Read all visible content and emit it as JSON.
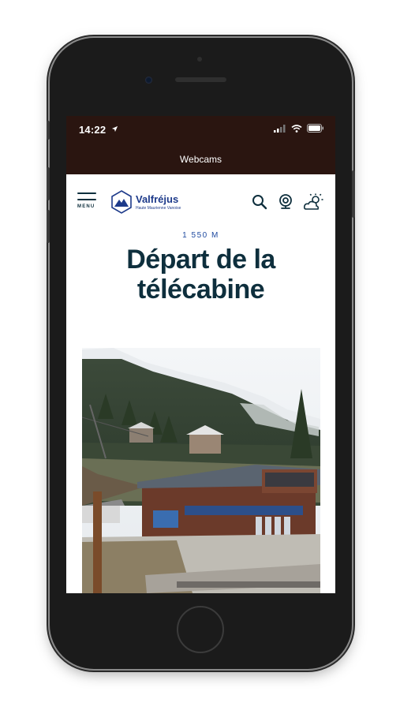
{
  "status_bar": {
    "time": "14:22"
  },
  "nav": {
    "title": "Webcams"
  },
  "header": {
    "menu_label": "MENU",
    "logo_name": "Valfréjus",
    "logo_tagline": "Haute Maurienne Vanoise"
  },
  "page": {
    "altitude": "1 550 M",
    "title_line1": "Départ de la",
    "title_line2": "télécabine"
  },
  "icons": [
    "location-arrow-icon",
    "signal-icon",
    "wifi-icon",
    "battery-icon",
    "search-icon",
    "webcam-icon",
    "weather-icon"
  ],
  "colors": {
    "status_bg": "#2a1510",
    "title": "#0e2f3d",
    "brand": "#1d3a8a"
  }
}
